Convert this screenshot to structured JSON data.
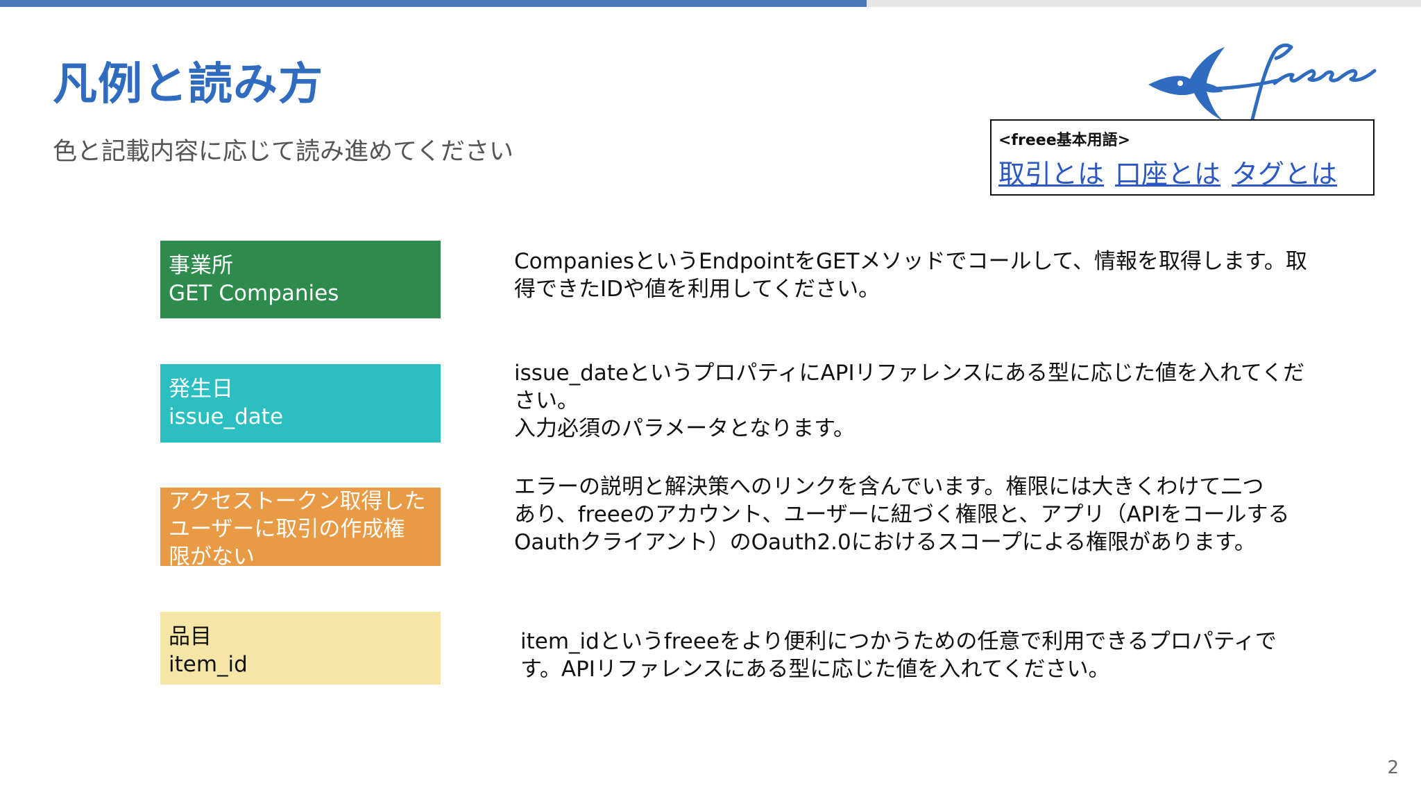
{
  "progress": {
    "fraction": 0.61,
    "color": "#4a78bd"
  },
  "page": {
    "title": "凡例と読み方",
    "subtitle": "色と記載内容に応じて読み進めてください",
    "number": "2"
  },
  "logo": {
    "alt": "freee",
    "icon": "swallow-logo",
    "color": "#2f6bbf"
  },
  "glossary": {
    "heading": "<freee基本用語>",
    "links": [
      {
        "label": "取引とは"
      },
      {
        "label": "口座とは"
      },
      {
        "label": "タグとは"
      }
    ]
  },
  "legend": [
    {
      "color": "#2e8b4e",
      "lines": [
        "事業所",
        "GET Companies"
      ],
      "description": [
        "CompaniesというEndpointをGETメソッドでコールして、情報を取得します。取",
        "得できたIDや値を利用してください。"
      ]
    },
    {
      "color": "#2bbfc2",
      "lines": [
        "発生日",
        "issue_date"
      ],
      "description": [
        "issue_dateというプロパティにAPIリファレンスにある型に応じた値を入れてくだ",
        "さい。",
        "入力必須のパラメータとなります。"
      ]
    },
    {
      "color": "#e99a44",
      "lines": [
        "アクセストークン取得した",
        "ユーザーに取引の作成権",
        "限がない"
      ],
      "description": [
        "エラーの説明と解決策へのリンクを含んでいます。権限には大きくわけて二つ",
        "あり、freeeのアカウント、ユーザーに紐づく権限と、アプリ（APIをコールする",
        "Oauthクライアント）のOauth2.0におけるスコープによる権限があります。"
      ]
    },
    {
      "color": "#f5e6a8",
      "lines": [
        "品目",
        "item_id"
      ],
      "description": [
        "item_idというfreeeをより便利につかうための任意で利用できるプロパティで",
        "す。APIリファレンスにある型に応じた値を入れてください。"
      ]
    }
  ]
}
